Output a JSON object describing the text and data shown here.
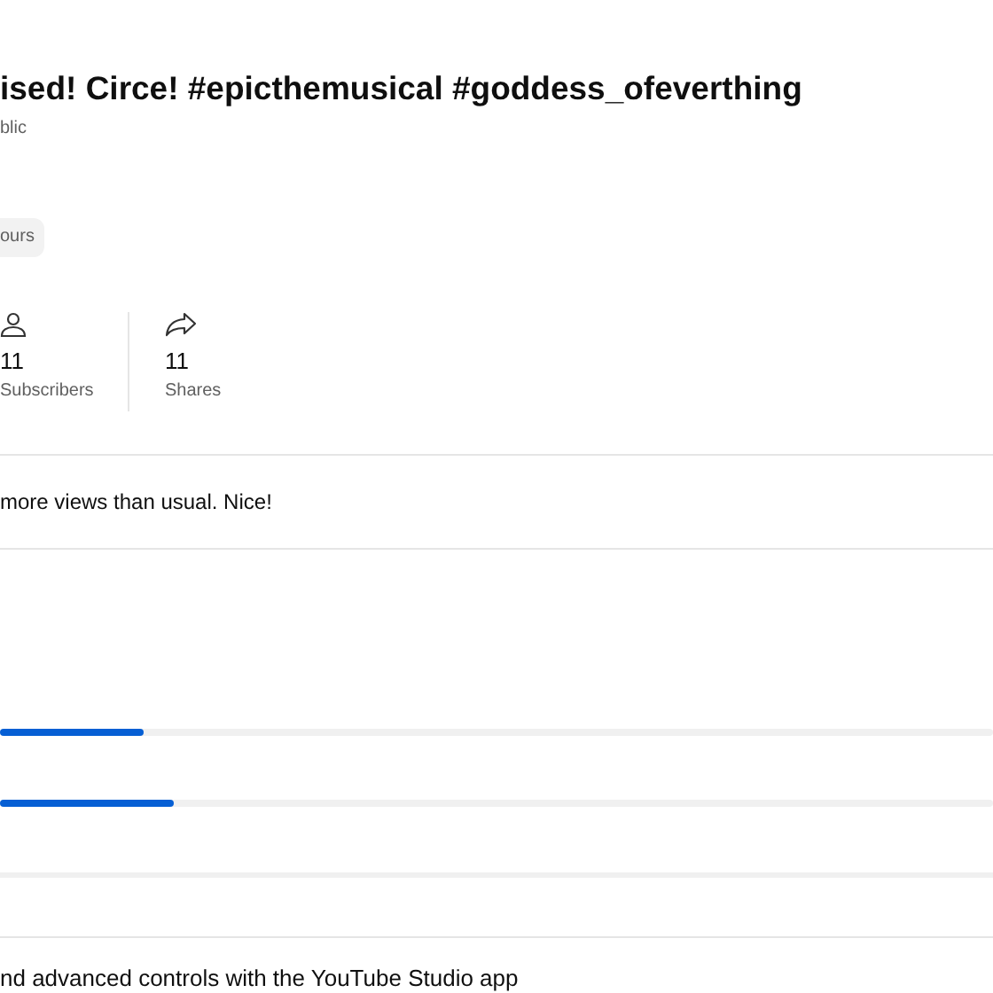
{
  "title": "ised! Circe! #epicthemusical #goddess_ofeverthing",
  "visibility": "blic",
  "chip": "ours",
  "stats": [
    {
      "kind": "subscribers",
      "value": "11",
      "label": "Subscribers"
    },
    {
      "kind": "shares",
      "value": "11",
      "label": "Shares"
    }
  ],
  "insight": "more views than usual. Nice!",
  "bars": [
    {
      "level": 0.145
    },
    {
      "level": 0.175
    }
  ],
  "promo": "nd advanced controls with the YouTube Studio app"
}
